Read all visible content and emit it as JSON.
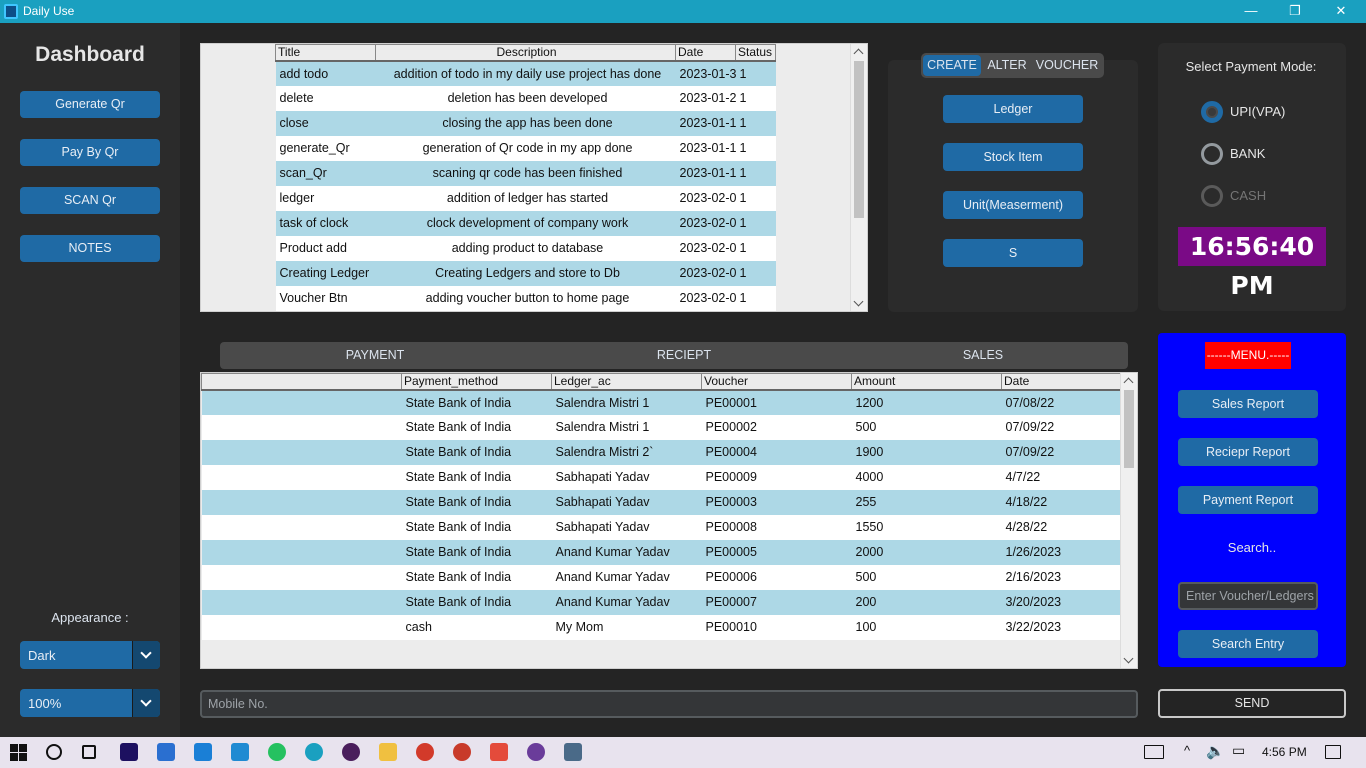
{
  "window": {
    "title": "Daily Use",
    "minimize_glyph": "—",
    "maximize_glyph": "❐",
    "close_glyph": "✕"
  },
  "sidebar": {
    "title": "Dashboard",
    "buttons": [
      "Generate Qr",
      "Pay By Qr",
      "SCAN Qr",
      "NOTES"
    ],
    "appearance_label": "Appearance :",
    "appearance_value": "Dark",
    "scaling_value": "100%"
  },
  "todo_table": {
    "columns": [
      "Title",
      "Description",
      "Date",
      "Status"
    ],
    "rows": [
      [
        "add todo",
        "addition of todo in my daily use project has done",
        "2023-01-3",
        "1"
      ],
      [
        "delete",
        "deletion has been developed",
        "2023-01-2",
        "1"
      ],
      [
        "close",
        "closing the app has been done",
        "2023-01-1",
        "1"
      ],
      [
        "generate_Qr",
        "generation of Qr code in my app done",
        "2023-01-1",
        "1"
      ],
      [
        "scan_Qr",
        "scaning qr code has been finished",
        "2023-01-1",
        "1"
      ],
      [
        "ledger",
        "addition of ledger has started",
        "2023-02-0",
        "1"
      ],
      [
        "task of clock",
        "clock development of company work",
        "2023-02-0",
        "1"
      ],
      [
        "Product add",
        "adding product to database",
        "2023-02-0",
        "1"
      ],
      [
        "Creating Ledger",
        "Creating Ledgers and store to Db",
        "2023-02-0",
        "1"
      ],
      [
        "Voucher Btn",
        "adding voucher button to home page",
        "2023-02-0",
        "1"
      ]
    ]
  },
  "create_panel": {
    "segments": [
      "CREATE",
      "ALTER",
      "VOUCHER"
    ],
    "active_segment": "CREATE",
    "buttons": [
      "Ledger",
      "Stock Item",
      "Unit(Measerment)",
      "S"
    ]
  },
  "payment_mode": {
    "label": "Select Payment Mode:",
    "options": [
      "UPI(VPA)",
      "BANK",
      "CASH"
    ],
    "selected": "UPI(VPA)",
    "disabled": "CASH",
    "clock": "16:56:40 PM"
  },
  "tabs": [
    "PAYMENT",
    "RECIEPT",
    "SALES"
  ],
  "payment_table": {
    "columns": [
      "",
      "Payment_method",
      "Ledger_ac",
      "Voucher",
      "Amount",
      "Date"
    ],
    "rows": [
      [
        "",
        "State Bank of India",
        "Salendra Mistri 1",
        "PE00001",
        "1200",
        "07/08/22"
      ],
      [
        "",
        "State Bank of India",
        "Salendra Mistri 1",
        "PE00002",
        "500",
        "07/09/22"
      ],
      [
        "",
        "State Bank of India",
        "Salendra Mistri 2`",
        "PE00004",
        "1900",
        "07/09/22"
      ],
      [
        "",
        "State Bank of India",
        "Sabhapati Yadav",
        "PE00009",
        "4000",
        "4/7/22"
      ],
      [
        "",
        "State Bank of India",
        "Sabhapati Yadav",
        "PE00003",
        "255",
        "4/18/22"
      ],
      [
        "",
        "State Bank of India",
        "Sabhapati Yadav",
        "PE00008",
        "1550",
        "4/28/22"
      ],
      [
        "",
        "State Bank of India",
        "Anand Kumar Yadav",
        "PE00005",
        "2000",
        "1/26/2023"
      ],
      [
        "",
        "State Bank of India",
        "Anand Kumar Yadav",
        "PE00006",
        "500",
        "2/16/2023"
      ],
      [
        "",
        "State Bank of India",
        "Anand Kumar Yadav",
        "PE00007",
        "200",
        "3/20/2023"
      ],
      [
        "",
        "cash",
        "My Mom",
        "PE00010",
        "100",
        "3/22/2023"
      ]
    ]
  },
  "menu": {
    "title": "------MENU.-----",
    "buttons": [
      "Sales Report",
      "Reciepr Report",
      "Payment Report"
    ],
    "search_label": "Search..",
    "search_placeholder": "Enter Voucher/Ledgers",
    "search_button": "Search Entry"
  },
  "bottom": {
    "mobile_placeholder": "Mobile No.",
    "send_label": "SEND"
  },
  "taskbar": {
    "time": "4:56 PM",
    "icons": [
      "windows-start-icon",
      "search-circle-icon",
      "task-view-icon",
      "premiere-pro-icon",
      "store-icon",
      "mail-icon",
      "vscode-icon",
      "whatsapp-icon",
      "edge-icon",
      "media-player-icon",
      "file-explorer-icon",
      "chrome-icon",
      "chrome-alt-icon",
      "anydesk-icon",
      "github-icon",
      "python-app-icon"
    ]
  }
}
